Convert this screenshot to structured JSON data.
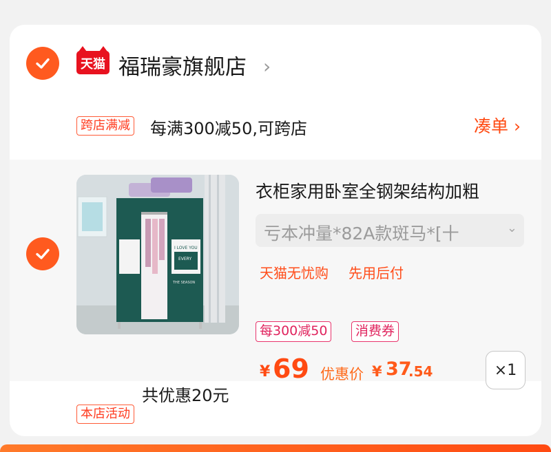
{
  "store": {
    "logo_text": "天猫",
    "name": "福瑞豪旗舰店",
    "chevron": "›"
  },
  "promo": {
    "tag": "跨店满减",
    "text": "每满300减50,可跨店",
    "action": "凑单 ›"
  },
  "product": {
    "title": "衣柜家用卧室全钢架结构加粗",
    "sku": "亏本冲量*82A款斑马*[十",
    "services": [
      "天猫无忧购",
      "先用后付"
    ],
    "badges": [
      "每300减50",
      "消费券"
    ],
    "price_symbol": "¥",
    "price": "69",
    "discount_label": "优惠价",
    "discount_symbol": "¥",
    "discount_int": "37",
    "discount_dec": ".54",
    "quantity": "×1",
    "image_words": [
      "EVERY",
      "THE SEASON",
      "I LOVE YOU"
    ]
  },
  "activity": {
    "tag": "本店活动",
    "text": "共优惠20元"
  },
  "colors": {
    "accent": "#ff5a1f",
    "tmall_red": "#e8121f",
    "coupon_pink": "#e0245e",
    "wardrobe_green": "#1d5a52"
  }
}
